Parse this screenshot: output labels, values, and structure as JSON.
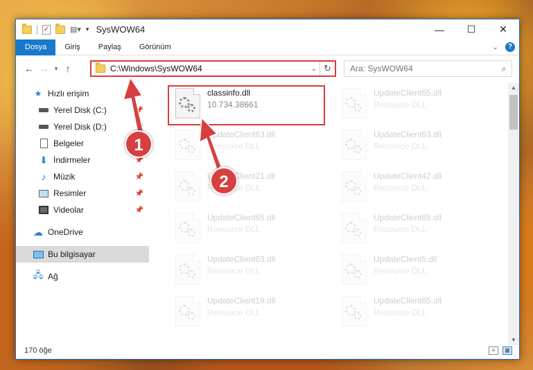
{
  "window": {
    "title": "SysWOW64",
    "controls": {
      "minimize": "—",
      "maximize": "☐",
      "close": "✕"
    }
  },
  "ribbon": {
    "tabs": [
      "Dosya",
      "Giriş",
      "Paylaş",
      "Görünüm"
    ],
    "help": "?"
  },
  "nav": {
    "address": "C:\\Windows\\SysWOW64",
    "search_placeholder": "Ara: SysWOW64"
  },
  "sidebar": {
    "quick_access": "Hızlı erişim",
    "items": [
      {
        "label": "Yerel Disk (C:)",
        "icon": "drive-icon",
        "pinned": true
      },
      {
        "label": "Yerel Disk (D:)",
        "icon": "drive-icon",
        "pinned": true
      },
      {
        "label": "Belgeler",
        "icon": "documents-icon",
        "pinned": true
      },
      {
        "label": "İndirmeler",
        "icon": "downloads-icon",
        "pinned": true
      },
      {
        "label": "Müzik",
        "icon": "music-icon",
        "pinned": true
      },
      {
        "label": "Resimler",
        "icon": "pictures-icon",
        "pinned": true
      },
      {
        "label": "Videolar",
        "icon": "videos-icon",
        "pinned": true
      }
    ],
    "onedrive": "OneDrive",
    "this_pc": "Bu bilgisayar",
    "network": "Ağ"
  },
  "files": [
    {
      "name": "classinfo.dll",
      "detail": "10.734.38661",
      "highlighted": true
    },
    {
      "name": "UpdateClient65.dll",
      "detail": "Resource DLL"
    },
    {
      "name": "UpdateClient63.dll",
      "detail": "Resource DLL"
    },
    {
      "name": "UpdateClient63.dll",
      "detail": "Resource DLL"
    },
    {
      "name": "UpdateClient21.dll",
      "detail": "Resource DLL"
    },
    {
      "name": "UpdateClient42.dll",
      "detail": "Resource DLL"
    },
    {
      "name": "UpdateClient65.dll",
      "detail": "Resource DLL"
    },
    {
      "name": "UpdateClient65.dll",
      "detail": "Resource DLL"
    },
    {
      "name": "UpdateClient63.dll",
      "detail": "Resource DLL"
    },
    {
      "name": "UpdateClient5.dll",
      "detail": "Resource DLL"
    },
    {
      "name": "UpdateClient19.dll",
      "detail": "Resource DLL"
    },
    {
      "name": "UpdateClient65.dll",
      "detail": "Resource DLL"
    }
  ],
  "status": {
    "count": "170 öğe"
  },
  "annotations": {
    "step1": "1",
    "step2": "2",
    "color": "#d64040"
  }
}
